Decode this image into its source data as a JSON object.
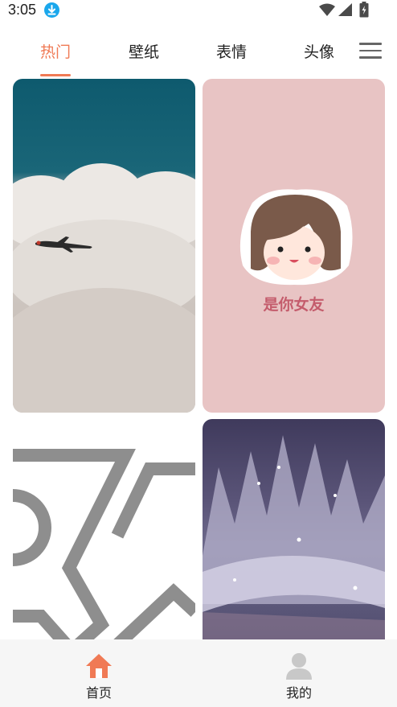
{
  "status_bar": {
    "time": "3:05",
    "icons": [
      "download-icon",
      "wifi-icon",
      "signal-icon",
      "battery-charging-icon"
    ]
  },
  "tabs": [
    {
      "label": "热门",
      "active": true
    },
    {
      "label": "壁纸",
      "active": false
    },
    {
      "label": "表情",
      "active": false
    },
    {
      "label": "头像",
      "active": false
    }
  ],
  "menu_icon": "menu-icon",
  "cards": [
    {
      "name": "airplane-clouds-wallpaper",
      "caption": ""
    },
    {
      "name": "cartoon-girl-avatar",
      "caption": "是你女友"
    },
    {
      "name": "abstract-logo-wallpaper",
      "caption": ""
    },
    {
      "name": "crystal-crown-wallpaper",
      "caption": ""
    }
  ],
  "bottom_nav": [
    {
      "label": "首页",
      "icon": "home-icon",
      "active": true
    },
    {
      "label": "我的",
      "icon": "user-icon",
      "active": false
    }
  ],
  "colors": {
    "accent": "#f07a55",
    "nav_background": "#f6f6f6",
    "inactive_icon": "#c8c8c8"
  }
}
